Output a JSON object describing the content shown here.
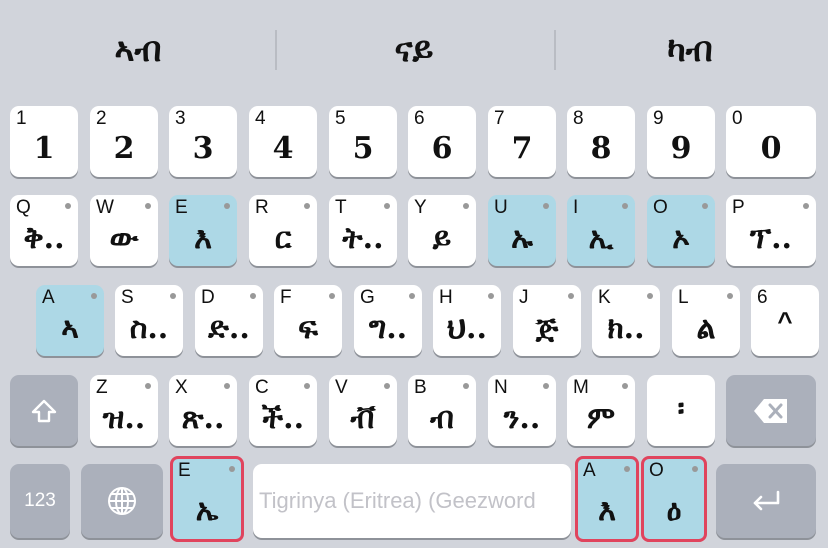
{
  "suggestions": [
    "ኣብ",
    "ናይ",
    "ካብ"
  ],
  "rows": {
    "numbers": [
      {
        "latin": "1",
        "main": "1"
      },
      {
        "latin": "2",
        "main": "2"
      },
      {
        "latin": "3",
        "main": "3"
      },
      {
        "latin": "4",
        "main": "4"
      },
      {
        "latin": "5",
        "main": "5"
      },
      {
        "latin": "6",
        "main": "6"
      },
      {
        "latin": "7",
        "main": "7"
      },
      {
        "latin": "8",
        "main": "8"
      },
      {
        "latin": "9",
        "main": "9"
      },
      {
        "latin": "0",
        "main": "0"
      }
    ],
    "row1": [
      {
        "latin": "Q",
        "main": "ቅ.."
      },
      {
        "latin": "W",
        "main": "ው"
      },
      {
        "latin": "E",
        "main": "እ"
      },
      {
        "latin": "R",
        "main": "ር"
      },
      {
        "latin": "T",
        "main": "ት.."
      },
      {
        "latin": "Y",
        "main": "ይ"
      },
      {
        "latin": "U",
        "main": "ኡ"
      },
      {
        "latin": "I",
        "main": "ኢ"
      },
      {
        "latin": "O",
        "main": "ኦ"
      },
      {
        "latin": "P",
        "main": "ፕ.."
      }
    ],
    "row2": [
      {
        "latin": "A",
        "main": "ኣ"
      },
      {
        "latin": "S",
        "main": "ስ.."
      },
      {
        "latin": "D",
        "main": "ድ.."
      },
      {
        "latin": "F",
        "main": "ፍ"
      },
      {
        "latin": "G",
        "main": "ግ.."
      },
      {
        "latin": "H",
        "main": "ህ.."
      },
      {
        "latin": "J",
        "main": "ጅ"
      },
      {
        "latin": "K",
        "main": "ክ.."
      },
      {
        "latin": "L",
        "main": "ል"
      },
      {
        "latin": "6",
        "main": "^"
      }
    ],
    "row3": [
      {
        "latin": "Z",
        "main": "ዝ.."
      },
      {
        "latin": "X",
        "main": "ጽ.."
      },
      {
        "latin": "C",
        "main": "ች.."
      },
      {
        "latin": "V",
        "main": "ቭ"
      },
      {
        "latin": "B",
        "main": "ብ"
      },
      {
        "latin": "N",
        "main": "ን.."
      },
      {
        "latin": "M",
        "main": "ም"
      },
      {
        "latin": "",
        "main": "፡"
      }
    ]
  },
  "bottom": {
    "numbers_label": "123",
    "e_key": {
      "latin": "E",
      "main": "ኤ"
    },
    "space_placeholder": "Tigrinya (Eritrea) (Geezword",
    "a_key": {
      "latin": "A",
      "main": "እ"
    },
    "o_key": {
      "latin": "O",
      "main": "ዕ"
    }
  },
  "icons": {
    "shift": "shift-arrow-icon",
    "backspace": "backspace-icon",
    "globe": "globe-icon",
    "return": "return-arrow-icon"
  },
  "colors": {
    "background": "#d1d4db",
    "key": "#ffffff",
    "vowel_key": "#add8e6",
    "function_key": "#abb0bb",
    "highlight_border": "#e0445d"
  }
}
